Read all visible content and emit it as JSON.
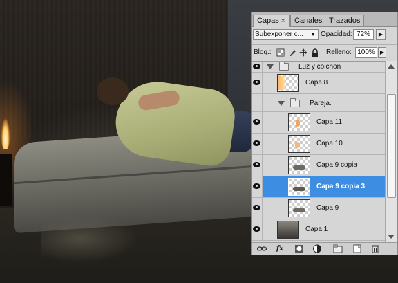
{
  "panel": {
    "tabs": [
      {
        "label": "Capas",
        "close": "×"
      },
      {
        "label": "Canales"
      },
      {
        "label": "Trazados"
      }
    ],
    "blend_mode": "Subexponer c...",
    "opacity_label": "Opacidad:",
    "opacity_value": "72%",
    "lock_label": "Bloq.:",
    "fill_label": "Relleno:",
    "fill_value": "100%",
    "lock_icons": [
      "lock-transparent-pixels-icon",
      "lock-image-pixels-icon",
      "lock-position-icon",
      "lock-all-icon"
    ],
    "bottom_icons": [
      "link-layers-icon",
      "layer-style-fx-icon",
      "add-mask-icon",
      "adjustment-layer-icon",
      "new-group-icon",
      "new-layer-icon",
      "delete-layer-icon"
    ],
    "fx_label": "fx"
  },
  "layers": [
    {
      "name": "Luz y colchon",
      "type": "group",
      "expanded": true,
      "indent": 0,
      "visible": true
    },
    {
      "name": "Capa 8",
      "type": "layer",
      "indent": 1,
      "visible": true
    },
    {
      "name": "Pareja.",
      "type": "group",
      "expanded": true,
      "indent": 1,
      "visible": false
    },
    {
      "name": "Capa 11",
      "type": "layer",
      "indent": 2,
      "visible": true
    },
    {
      "name": "Capa 10",
      "type": "layer",
      "indent": 2,
      "visible": true
    },
    {
      "name": "Capa 9 copia",
      "type": "layer",
      "indent": 2,
      "visible": true
    },
    {
      "name": "Capa 9 copia 3",
      "type": "layer",
      "indent": 2,
      "visible": true,
      "selected": true
    },
    {
      "name": "Capa 9",
      "type": "layer",
      "indent": 2,
      "visible": true
    },
    {
      "name": "Capa 1",
      "type": "layer",
      "indent": 0,
      "visible": true
    }
  ],
  "colors": {
    "selected_row": "#3d8ee2",
    "panel_bg": "#d6d6d6"
  }
}
